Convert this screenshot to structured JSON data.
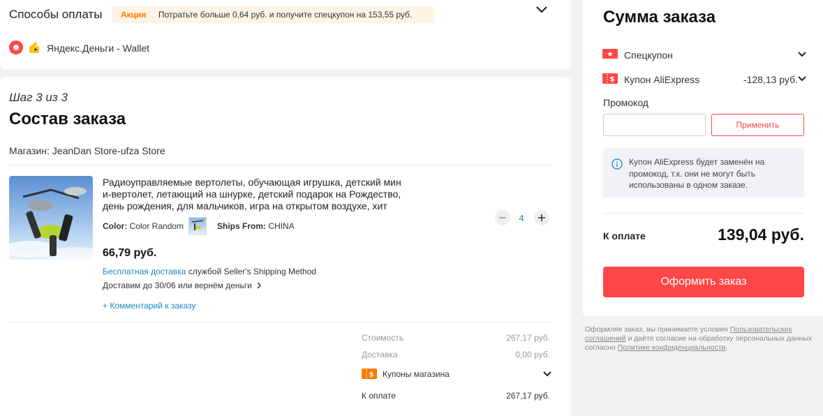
{
  "payment": {
    "title": "Способы оплаты",
    "promo_badge": "Акция",
    "promo_text": "Потратьте больше 0,64 руб. и получите спецкупон на 153,55 руб.",
    "method": "Яндекс.Деньги - Wallet"
  },
  "order": {
    "step": "Шаг 3 из 3",
    "title": "Состав заказа",
    "store": "Магазин: JeanDan Store-ufza Store",
    "product": {
      "title_line1": "Радиоуправляемые вертолеты, обучающая игрушка, детский мин",
      "title_line2": "и-вертолет, летающий на шнурке, детский подарок на Рождество,",
      "title_line3": "день рождения, для мальчиков, игра на открытом воздухе, хит",
      "color_label": "Color:",
      "color_value": "Color Random",
      "ships_label": "Ships From:",
      "ships_value": "CHINA",
      "price": "66,79 руб.",
      "free_shipping": "Бесплатная доставка",
      "shipping_method": "службой Seller's Shipping Method",
      "delivery": "Доставим до 30/06 или вернём деньги",
      "comment": "+ Комментарий к заказу",
      "quantity": "4"
    },
    "summary": {
      "cost_label": "Стоимость",
      "cost_value": "267,17 руб.",
      "delivery_label": "Доставка",
      "delivery_value": "0,00 руб.",
      "coupons_label": "Купоны магазина",
      "total_label": "К оплате",
      "total_value": "267,17 руб."
    }
  },
  "sidebar": {
    "title": "Сумма заказа",
    "special_coupon": "Спецкупон",
    "ali_coupon": "Купон AliExpress",
    "ali_coupon_value": "-128,13 руб.",
    "promo_label": "Промокод",
    "promo_placeholder": "",
    "apply_button": "Применить",
    "info_text_1": "Купон AliExpress будет заменён на",
    "info_text_2": "промокод, т.к. они не могут быть",
    "info_text_3": "использованы в одном заказе.",
    "total_label": "К оплате",
    "total_value": "139,04 руб.",
    "checkout_button": "Оформить заказ",
    "legal_1": "Оформляя заказ, вы принимаете условия",
    "legal_link_1": "Пользовательских",
    "legal_link_2": "соглашений",
    "legal_2": "и даёте согласие на обработку персональных данных",
    "legal_3": "согласно",
    "legal_link_3": "Политике конфиденциальности",
    "legal_end": "."
  },
  "colors": {
    "accent": "#ff4747",
    "promo_bg": "#fff3e6",
    "promo_text": "#ff7a00",
    "link": "#1e87c7"
  }
}
